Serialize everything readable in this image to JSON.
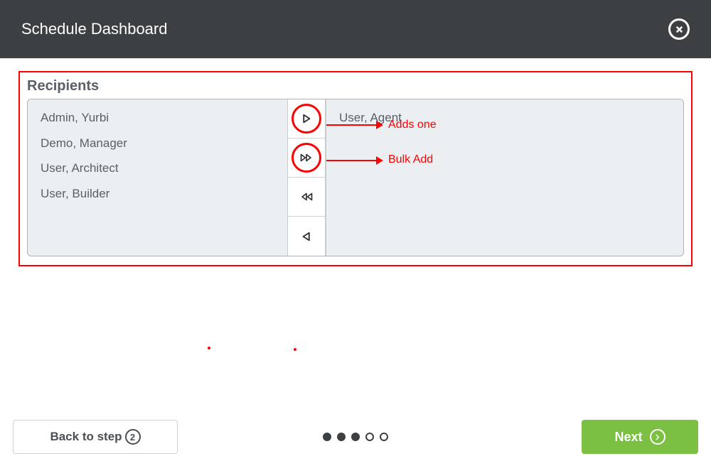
{
  "header": {
    "title": "Schedule Dashboard"
  },
  "recipients": {
    "label": "Recipients",
    "available": [
      "Admin, Yurbi",
      "Demo, Manager",
      "User, Architect",
      "User, Builder"
    ],
    "selected": [
      "User, Agent"
    ]
  },
  "annotations": {
    "adds_one": "Adds one",
    "bulk_add": "Bulk Add"
  },
  "footer": {
    "back_label": "Back to step",
    "back_step": "2",
    "next_label": "Next",
    "progress": {
      "current": 3,
      "total": 5
    }
  }
}
